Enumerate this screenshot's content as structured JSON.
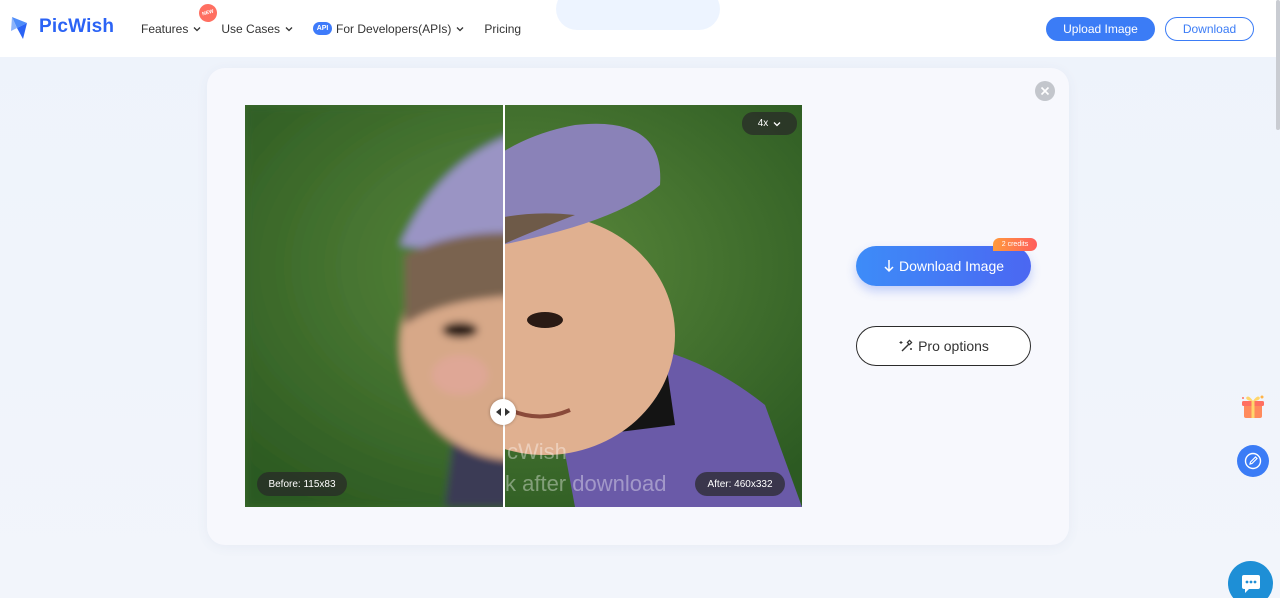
{
  "header": {
    "logo_text": "PicWish",
    "nav": [
      {
        "label": "Features",
        "badge": "NEW"
      },
      {
        "label": "Use Cases"
      },
      {
        "label": "For Developers(APIs)",
        "prefix_badge": "API"
      },
      {
        "label": "Pricing"
      }
    ],
    "upload_label": "Upload Image",
    "download_label": "Download"
  },
  "viewer": {
    "zoom": "4x",
    "before_label": "Before: 115x83",
    "after_label": "After: 460x332",
    "watermark_line1": "cWish",
    "watermark_line2": "k after download"
  },
  "actions": {
    "download_image_label": "Download Image",
    "credits_badge": "2 credits",
    "pro_options_label": "Pro options"
  },
  "icons": {
    "close": "close-icon",
    "split_handle": "arrows-left-right-icon",
    "gift": "gift-icon",
    "edit": "edit-icon",
    "chat": "chat-icon"
  },
  "colors": {
    "brand": "#2b63f5",
    "primary_button": "#3b7cf6",
    "credits_badge": "#ff5d5d",
    "chat_widget": "#1e8fd6"
  }
}
